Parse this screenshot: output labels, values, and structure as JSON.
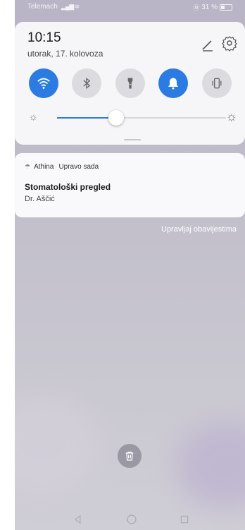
{
  "status_bar": {
    "carrier": "Telemach",
    "signal": "..ıl",
    "battery_text": "31 %"
  },
  "quick_settings": {
    "time": "10:15",
    "date": "utorak, 17. kolovoza",
    "tiles": [
      {
        "name": "wifi",
        "state": "on"
      },
      {
        "name": "bluetooth",
        "state": "off"
      },
      {
        "name": "flashlight",
        "state": "off"
      },
      {
        "name": "sound",
        "state": "on"
      },
      {
        "name": "vibration",
        "state": "off"
      }
    ],
    "brightness_level": 0.35,
    "accent_color": "#2b7be3"
  },
  "notification": {
    "app": "Athina",
    "time": "Upravo sada",
    "title": "Stomatološki pregled",
    "text": "Dr. Aščić"
  },
  "manage_link": "Upravljaj obavijestima"
}
